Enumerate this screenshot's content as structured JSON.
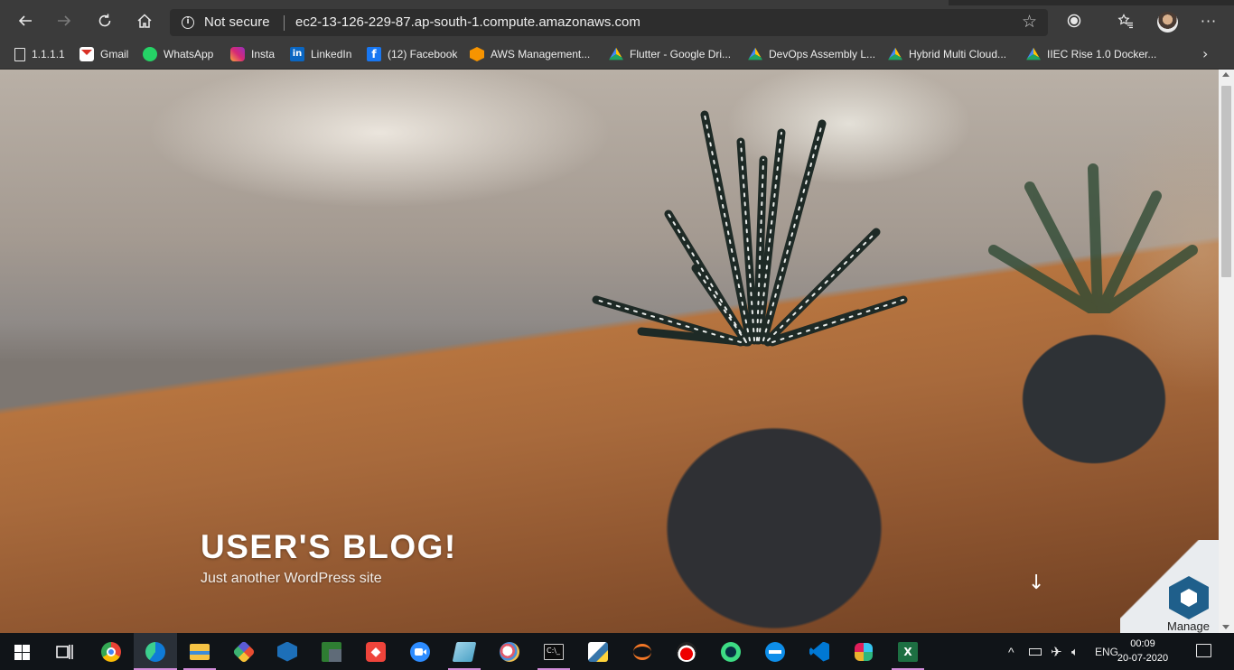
{
  "browser": {
    "security_label": "Not secure",
    "url": "ec2-13-126-229-87.ap-south-1.compute.amazonaws.com",
    "icons": [
      "back-icon",
      "forward-icon",
      "reload-icon",
      "home-icon",
      "info-icon",
      "star-icon",
      "extension-icon",
      "favorites-icon",
      "profile-avatar",
      "more-icon"
    ]
  },
  "bookmarks": [
    {
      "label": "1.1.1.1",
      "icon": "page-icon"
    },
    {
      "label": "Gmail",
      "icon": "gmail-icon"
    },
    {
      "label": "WhatsApp",
      "icon": "whatsapp-icon"
    },
    {
      "label": "Insta",
      "icon": "instagram-icon"
    },
    {
      "label": "LinkedIn",
      "icon": "linkedin-icon"
    },
    {
      "label": "(12) Facebook",
      "icon": "facebook-icon"
    },
    {
      "label": "AWS Management...",
      "icon": "aws-icon"
    },
    {
      "label": "Flutter - Google Dri...",
      "icon": "google-drive-icon"
    },
    {
      "label": "DevOps Assembly L...",
      "icon": "google-drive-icon"
    },
    {
      "label": "Hybrid Multi Cloud...",
      "icon": "google-drive-icon"
    },
    {
      "label": "IIEC Rise 1.0 Docker...",
      "icon": "google-drive-icon"
    }
  ],
  "site": {
    "title": "USER'S BLOG!",
    "tagline": "Just another WordPress site"
  },
  "manage_badge": {
    "label": "Manage"
  },
  "taskbar": {
    "apps": [
      "task-view",
      "chrome",
      "edge",
      "file-explorer",
      "git-kraken",
      "virtualbox",
      "putty-transfer",
      "anydesk",
      "zoom",
      "notepad",
      "paint",
      "terminal",
      "python",
      "jupyter",
      "redhat",
      "android-studio",
      "teamviewer",
      "vscode",
      "slack",
      "excel"
    ],
    "language": "ENG",
    "time": "00:09",
    "date": "20-07-2020"
  },
  "colors": {
    "toolbar": "#3b3b3b",
    "taskbar": "#101418",
    "active_indicator": "#d28cd9"
  }
}
